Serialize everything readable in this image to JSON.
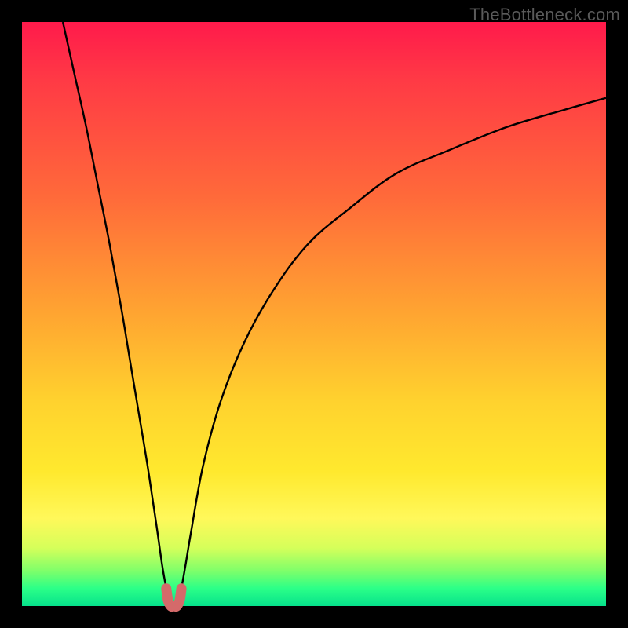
{
  "watermark": "TheBottleneck.com",
  "colors": {
    "curve": "#000000",
    "notch": "#d46a6a",
    "background_stops": [
      "#ff1a4b",
      "#ff3a45",
      "#ff6a3a",
      "#ffa531",
      "#ffd22e",
      "#ffe92e",
      "#fff85a",
      "#d6ff5a",
      "#7eff6a",
      "#2bff88",
      "#06e28b"
    ]
  },
  "chart_data": {
    "type": "line",
    "title": "",
    "xlabel": "",
    "ylabel": "",
    "xlim": [
      0,
      100
    ],
    "ylim": [
      0,
      100
    ],
    "annotations": [],
    "series": [
      {
        "name": "left-branch",
        "x": [
          7,
          9,
          11,
          13,
          15,
          17,
          18.5,
          20,
          21.5,
          23,
          24,
          24.7
        ],
        "y": [
          100,
          91,
          82,
          72,
          62,
          51,
          42,
          33,
          24,
          14,
          7,
          3
        ]
      },
      {
        "name": "right-branch",
        "x": [
          27.3,
          28,
          29,
          31,
          34,
          38,
          43,
          49,
          56,
          64,
          73,
          83,
          93,
          100
        ],
        "y": [
          3,
          7,
          13,
          24,
          35,
          45,
          54,
          62,
          68,
          74,
          78,
          82,
          85,
          87
        ]
      },
      {
        "name": "valley-notch",
        "x": [
          24.7,
          25,
          25.5,
          26,
          26.5,
          27,
          27.3
        ],
        "y": [
          3,
          1,
          0,
          0,
          0,
          1,
          3
        ]
      }
    ],
    "notch_color": "#d46a6a"
  }
}
